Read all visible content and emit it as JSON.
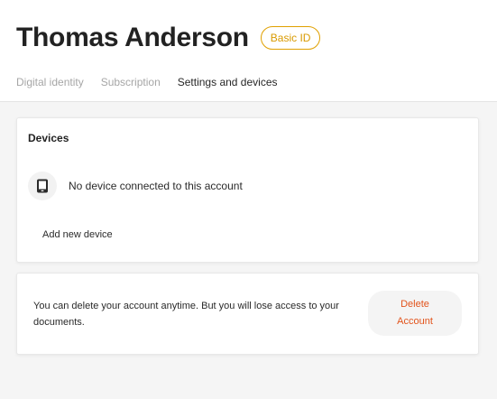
{
  "profile": {
    "name": "Thomas Anderson",
    "plan_badge": "Basic ID"
  },
  "tabs": [
    {
      "label": "Digital identity",
      "active": false
    },
    {
      "label": "Subscription",
      "active": false
    },
    {
      "label": "Settings and devices",
      "active": true
    }
  ],
  "devices": {
    "title": "Devices",
    "empty_message": "No device connected to this account",
    "device_icon": "tablet-icon",
    "add_label": "Add new device"
  },
  "account": {
    "delete_info": "You can delete your account anytime. But you will lose access to your documents.",
    "delete_label": "Delete Account"
  },
  "colors": {
    "badge": "#d99a00",
    "danger": "#e2541c",
    "active_tab": "#262626",
    "inactive_tab": "#a6a6a6"
  }
}
